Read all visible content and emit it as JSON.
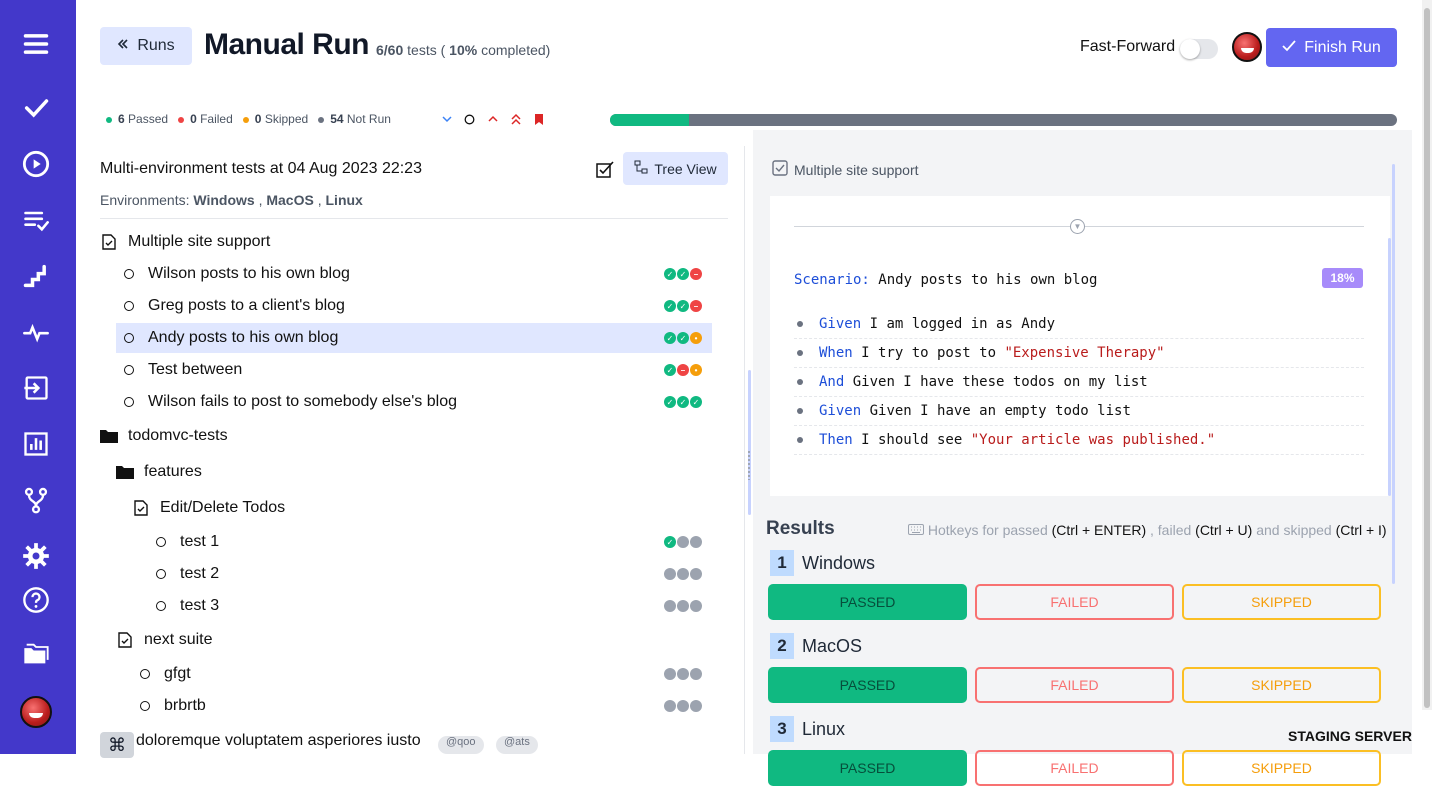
{
  "sidebar": {
    "items": [
      {
        "icon": "menu-icon"
      },
      {
        "icon": "check-icon"
      },
      {
        "icon": "play-circle-icon"
      },
      {
        "icon": "checklist-icon"
      },
      {
        "icon": "steps-icon"
      },
      {
        "icon": "pulse-icon"
      },
      {
        "icon": "import-icon"
      },
      {
        "icon": "bar-chart-icon"
      },
      {
        "icon": "branch-icon"
      },
      {
        "icon": "gear-icon"
      },
      {
        "icon": "help-icon"
      },
      {
        "icon": "folders-icon"
      }
    ]
  },
  "header": {
    "back_label": "Runs",
    "title": "Manual Run",
    "tests_done": "6/60",
    "tests_word": "tests (",
    "percent": "10%",
    "completed": "completed)",
    "fast_forward": "Fast-Forward",
    "finish_label": "Finish Run"
  },
  "stats": {
    "passed_count": "6",
    "passed_label": "Passed",
    "failed_count": "0",
    "failed_label": "Failed",
    "skipped_count": "0",
    "skipped_label": "Skipped",
    "notrun_count": "54",
    "notrun_label": "Not Run",
    "progress_fraction": 0.1
  },
  "run": {
    "title": "Multi-environment tests at 04 Aug 2023 22:23",
    "env_prefix": "Environments:",
    "envs": [
      "Windows",
      "MacOS",
      "Linux"
    ],
    "tree_view_label": "Tree View"
  },
  "tree": [
    {
      "label": "Multiple site support",
      "type": "suite"
    },
    {
      "label": "Wilson posts to his own blog",
      "type": "test",
      "status": [
        "pass",
        "pass",
        "fail"
      ]
    },
    {
      "label": "Greg posts to a client's blog",
      "type": "test",
      "status": [
        "pass",
        "pass",
        "fail"
      ]
    },
    {
      "label": "Andy posts to his own blog",
      "type": "test",
      "status": [
        "pass",
        "pass",
        "skip"
      ]
    },
    {
      "label": "Test between",
      "type": "test",
      "status": [
        "pass",
        "fail",
        "skip"
      ]
    },
    {
      "label": "Wilson fails to post to somebody else's blog",
      "type": "test",
      "status": [
        "pass",
        "pass",
        "pass"
      ]
    },
    {
      "label": "todomvc-tests",
      "type": "folder"
    },
    {
      "label": "features",
      "type": "folder"
    },
    {
      "label": "Edit/Delete Todos",
      "type": "suite"
    },
    {
      "label": "test 1",
      "type": "test",
      "status": [
        "pass",
        "none",
        "none"
      ]
    },
    {
      "label": "test 2",
      "type": "test",
      "status": [
        "none",
        "none",
        "none"
      ]
    },
    {
      "label": "test 3",
      "type": "test",
      "status": [
        "none",
        "none",
        "none"
      ]
    },
    {
      "label": "next suite",
      "type": "suite"
    },
    {
      "label": "gfgt",
      "type": "test",
      "status": [
        "none",
        "none",
        "none"
      ]
    },
    {
      "label": "brbrtb",
      "type": "test",
      "status": [
        "none",
        "none",
        "none"
      ]
    },
    {
      "label": "doloremque voluptatem asperiores iusto",
      "type": "test"
    }
  ],
  "tags": [
    "@qoo",
    "@ats"
  ],
  "detail": {
    "suite_label": "Multiple site support",
    "scenario_kw": "Scenario:",
    "scenario_title": "Andy posts to his own blog",
    "percent": "18%",
    "steps": [
      {
        "kw": "Given",
        "text": "I am logged in as Andy",
        "str": ""
      },
      {
        "kw": "When",
        "text": "I try to post to",
        "str": "\"Expensive Therapy\""
      },
      {
        "kw": "And",
        "text": "Given I have these todos on my list",
        "str": ""
      },
      {
        "kw": "Given",
        "text": "Given I have an empty todo list",
        "str": ""
      },
      {
        "kw": "Then",
        "text": "I should see",
        "str": "\"Your article was published.\""
      }
    ]
  },
  "results": {
    "title": "Results",
    "hotkeys_prefix": "Hotkeys for passed",
    "hotkey_pass": "(Ctrl + ENTER)",
    "hotkeys_failed": ", failed",
    "hotkey_fail": "(Ctrl + U)",
    "hotkeys_skipped": "and skipped",
    "hotkey_skip": "(Ctrl + I)",
    "envs": [
      {
        "num": "1",
        "name": "Windows"
      },
      {
        "num": "2",
        "name": "MacOS"
      },
      {
        "num": "3",
        "name": "Linux"
      }
    ],
    "passed": "PASSED",
    "failed": "FAILED",
    "skipped": "SKIPPED"
  },
  "footer": {
    "staging": "STAGING SERVER"
  },
  "colors": {
    "sidebar": "#4338ca",
    "accent": "#6366f1",
    "pass": "#10b981",
    "fail": "#ef4444",
    "skip": "#f59e0b"
  }
}
